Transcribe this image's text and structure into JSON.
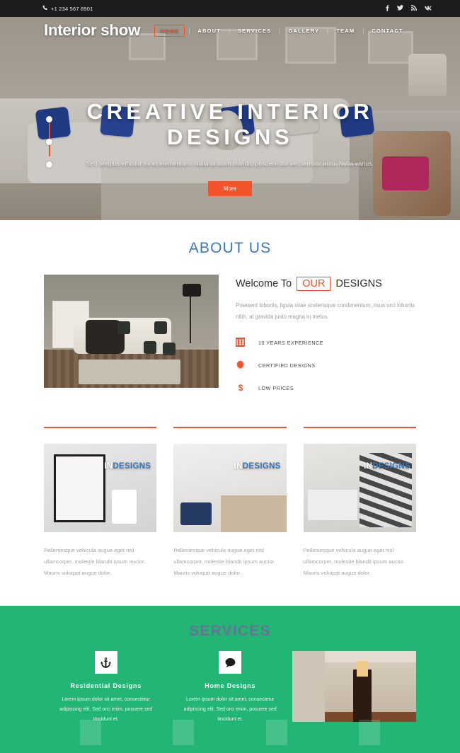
{
  "topbar": {
    "phone": "+1 234 567 8901",
    "phone_icon": "phone-icon",
    "socials": [
      {
        "name": "facebook-icon",
        "glyph": "f"
      },
      {
        "name": "twitter-icon",
        "glyph": "✒"
      },
      {
        "name": "rss-icon",
        "glyph": "♪"
      },
      {
        "name": "vk-icon",
        "glyph": "В"
      }
    ]
  },
  "header": {
    "logo": "Interior show",
    "menu": [
      {
        "label": "HOME",
        "active": true
      },
      {
        "label": "ABOUT",
        "active": false
      },
      {
        "label": "SERVICES",
        "active": false
      },
      {
        "label": "GALLERY",
        "active": false
      },
      {
        "label": "TEAM",
        "active": false
      },
      {
        "label": "CONTACT",
        "active": false
      }
    ],
    "separator": "|"
  },
  "hero": {
    "title_line1": "CREATIVE INTERIOR",
    "title_line2": "DESIGNS",
    "subtitle": "Sed tempus efficitur ex et elementum. Nulla at diam blandit, posuere dui vel, tempor arcu. Nulla varius.",
    "button": "More",
    "slider_dots": 3
  },
  "about": {
    "section_title": "ABOUT US",
    "welcome_prefix": "Welcome To",
    "welcome_highlight": "OUR",
    "welcome_suffix": "DESIGNS",
    "paragraph": "Praesent lobortis, ligula vitae scelerisque condimentum, risus orci lobortis nibh, at gravida justo magna in metus.",
    "features": [
      {
        "icon": "calendar-grid-icon",
        "label": "10 YEARS EXPERIENCE"
      },
      {
        "icon": "certificate-sun-icon",
        "label": "CERTIFIED DESIGNS"
      },
      {
        "icon": "dollar-icon",
        "label": "LOW PRICES"
      }
    ]
  },
  "cards": [
    {
      "overlay_white": "IN",
      "overlay_blue": "DESIGNS",
      "text": "Pellentesque vehicula augue eget nisl ullamcorper, molestie blandit ipsum auctor. Mauris volutpat augue dolor."
    },
    {
      "overlay_white": "IN",
      "overlay_blue": "DESIGNS",
      "text": "Pellentesque vehicula augue eget nisl ullamcorper, molestie blandit ipsum auctor. Mauris volutpat augue dolor."
    },
    {
      "overlay_white": "IN",
      "overlay_blue": "DESIGNS",
      "text": "Pellentesque vehicula augue eget nisl ullamcorper, molestie blandit ipsum auctor. Mauris volutpat augue dolor."
    }
  ],
  "services": {
    "section_title": "SERVICES",
    "items": [
      {
        "icon": "anchor-icon",
        "title": "Residential Designs",
        "text": "Lorem ipsum dolor sit amet, consectetur adipiscing elit. Sed orci enim, posuere sed tincidunt et."
      },
      {
        "icon": "comment-bubble-icon",
        "title": "Home Designs",
        "text": "Lorem ipsum dolor sit amet, consectetur adipiscing elit. Sed orci enim, posuere sed tincidunt et."
      }
    ]
  },
  "colors": {
    "accent_orange": "#f1542a",
    "link_blue": "#3b78b5",
    "services_green": "#22b573",
    "topbar_dark": "#1c1c1c"
  }
}
